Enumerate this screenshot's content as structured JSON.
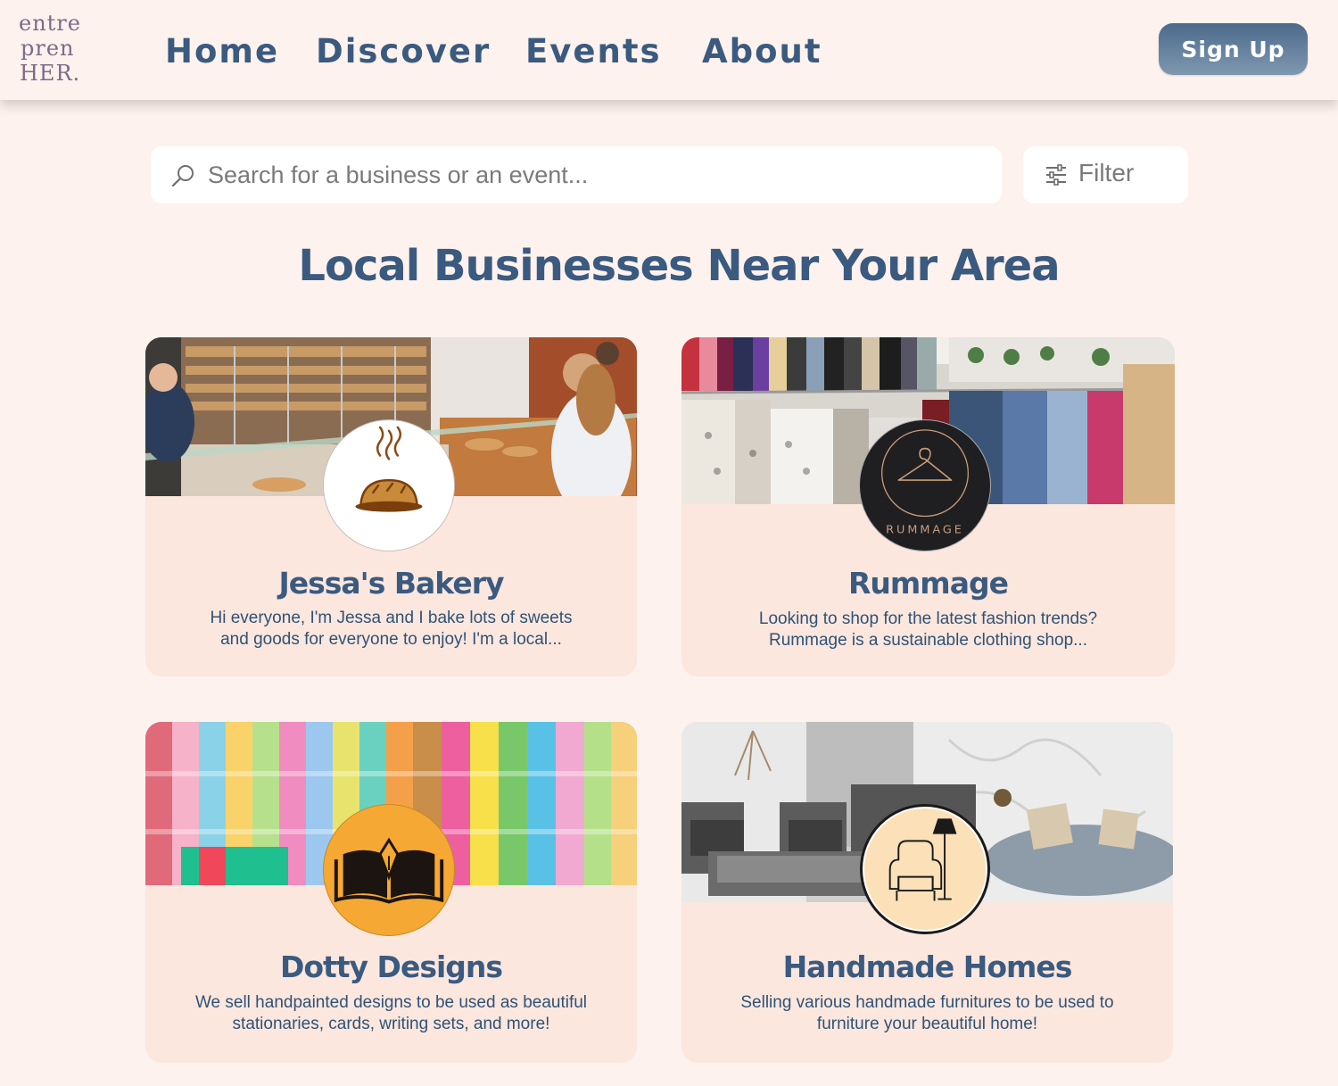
{
  "header": {
    "logo_lines": [
      "entre",
      "pren",
      "HER."
    ],
    "nav": [
      "Home",
      "Discover",
      "Events",
      "About"
    ],
    "signup_label": "Sign Up"
  },
  "search": {
    "placeholder": "Search for a business or an event...",
    "value": "",
    "icon": "search-icon"
  },
  "filter": {
    "label": "Filter",
    "icon": "sliders-icon"
  },
  "main": {
    "title": "Local Businesses Near Your Area",
    "cards": [
      {
        "name": "Jessa's Bakery",
        "desc_lines": [
          "Hi everyone, I'm Jessa and I bake lots of sweets",
          "and goods for everyone to enjoy! I'm a local..."
        ],
        "logo": "bread-icon"
      },
      {
        "name": "Rummage",
        "desc_lines": [
          "Looking to shop for the latest fashion trends?",
          "Rummage is a sustainable clothing shop..."
        ],
        "logo": "hanger-icon",
        "logo_text": "RUMMAGE"
      },
      {
        "name": "Dotty Designs",
        "desc_lines": [
          "We sell handpainted designs to be used as beautiful",
          "stationaries, cards, writing sets, and more!"
        ],
        "logo": "book-pen-icon"
      },
      {
        "name": "Handmade Homes",
        "desc_lines": [
          "Selling various handmade furnitures to be used to",
          "furniture your beautiful home!"
        ],
        "logo": "armchair-icon"
      }
    ]
  },
  "colors": {
    "background": "#fdf2ed",
    "card": "#fbe7de",
    "primary": "#3b5a80",
    "logo": "#80698a",
    "dotty_logo_bg": "#f5a833",
    "handmade_logo_bg": "#fbe0b8",
    "rummage_logo_bg": "#1f1f22"
  }
}
